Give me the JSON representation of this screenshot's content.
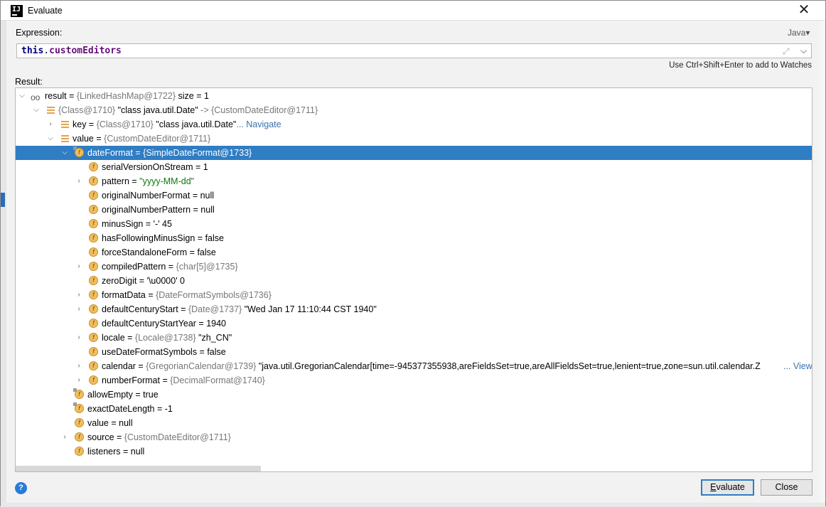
{
  "window": {
    "title": "Evaluate",
    "app_icon_text": "IJ"
  },
  "expression": {
    "label": "Expression:",
    "value_kw": "this",
    "value_dot": ".",
    "value_field": "customEditors",
    "language": "Java"
  },
  "hint": "Use Ctrl+Shift+Enter to add to Watches",
  "result_label": "Result:",
  "tree": {
    "rows": [
      {
        "name": "result",
        "rest": " = ",
        "ref": "{LinkedHashMap@1722}",
        "value": "  size = 1"
      },
      {
        "name": "",
        "ref": "{Class@1710}",
        "value": " \"class java.util.Date\" ",
        "arrow": "->",
        "ref2": " {CustomDateEditor@1711}"
      },
      {
        "name": "key",
        "rest": " = ",
        "ref": "{Class@1710}",
        "value": " \"class java.util.Date\"",
        "link": "... Navigate"
      },
      {
        "name": "value",
        "rest": " = ",
        "ref": "{CustomDateEditor@1711}"
      },
      {
        "name": "dateFormat",
        "rest": " = ",
        "ref": "{SimpleDateFormat@1733}"
      },
      {
        "name": "serialVersionOnStream",
        "value": " = 1"
      },
      {
        "name": "pattern",
        "rest": " = ",
        "str": "\"yyyy-MM-dd\""
      },
      {
        "name": "originalNumberFormat",
        "value": " = null"
      },
      {
        "name": "originalNumberPattern",
        "value": " = null"
      },
      {
        "name": "minusSign",
        "value": " = '-' 45"
      },
      {
        "name": "hasFollowingMinusSign",
        "value": " = false"
      },
      {
        "name": "forceStandaloneForm",
        "value": " = false"
      },
      {
        "name": "compiledPattern",
        "rest": " = ",
        "ref": "{char[5]@1735}"
      },
      {
        "name": "zeroDigit",
        "value": " = '\\u0000' 0"
      },
      {
        "name": "formatData",
        "rest": " = ",
        "ref": "{DateFormatSymbols@1736}"
      },
      {
        "name": "defaultCenturyStart",
        "rest": " = ",
        "ref": "{Date@1737}",
        "value": " \"Wed Jan 17 11:10:44 CST 1940\""
      },
      {
        "name": "defaultCenturyStartYear",
        "value": " = 1940"
      },
      {
        "name": "locale",
        "rest": " = ",
        "ref": "{Locale@1738}",
        "value": " \"zh_CN\""
      },
      {
        "name": "useDateFormatSymbols",
        "value": " = false"
      },
      {
        "name": "calendar",
        "rest": " = ",
        "ref": "{GregorianCalendar@1739}",
        "value": " \"java.util.GregorianCalendar[time=-945377355938,areFieldsSet=true,areAllFieldsSet=true,lenient=true,zone=sun.util.calendar.Z",
        "link": "... View"
      },
      {
        "name": "numberFormat",
        "rest": " = ",
        "ref": "{DecimalFormat@1740}"
      },
      {
        "name": "allowEmpty",
        "value": " = true"
      },
      {
        "name": "exactDateLength",
        "value": " = -1"
      },
      {
        "name": "value",
        "value": " = null"
      },
      {
        "name": "source",
        "rest": " = ",
        "ref": "{CustomDateEditor@1711}"
      },
      {
        "name": "listeners",
        "value": " = null"
      }
    ]
  },
  "buttons": {
    "evaluate_u": "E",
    "evaluate_rest": "valuate",
    "close": "Close"
  },
  "help_glyph": "?"
}
